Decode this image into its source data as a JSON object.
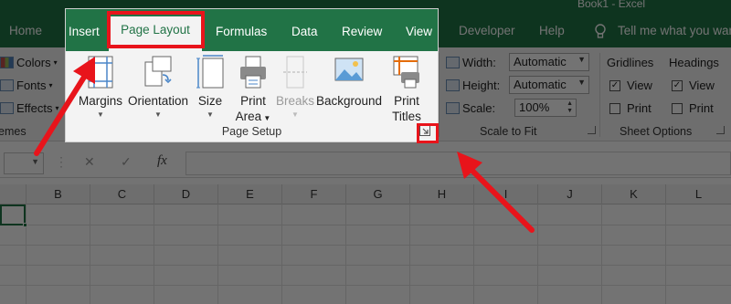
{
  "window": {
    "title": "Book1 - Excel"
  },
  "tabs": [
    "Home",
    "Insert",
    "Page Layout",
    "Formulas",
    "Data",
    "Review",
    "View",
    "Developer",
    "Help"
  ],
  "active_tab": "Page Layout",
  "tell_me": "Tell me what you want",
  "themes": {
    "colors": "Colors",
    "fonts": "Fonts",
    "effects": "Effects",
    "group": "emes"
  },
  "page_setup": {
    "commands": [
      {
        "label": "Margins",
        "sub": "",
        "caret": true,
        "icon": "margins-icon"
      },
      {
        "label": "Orientation",
        "sub": "",
        "caret": true,
        "icon": "orientation-icon"
      },
      {
        "label": "Size",
        "sub": "",
        "caret": true,
        "icon": "size-icon"
      },
      {
        "label": "Print",
        "sub": "Area",
        "caret": true,
        "icon": "print-area-icon"
      },
      {
        "label": "Breaks",
        "sub": "",
        "caret": true,
        "icon": "breaks-icon",
        "disabled": true
      },
      {
        "label": "Background",
        "sub": "",
        "caret": false,
        "icon": "background-icon"
      },
      {
        "label": "Print",
        "sub": "Titles",
        "caret": false,
        "icon": "print-titles-icon"
      }
    ],
    "group": "Page Setup"
  },
  "scale_to_fit": {
    "width_label": "Width:",
    "width_value": "Automatic",
    "height_label": "Height:",
    "height_value": "Automatic",
    "scale_label": "Scale:",
    "scale_value": "100%",
    "group": "Scale to Fit"
  },
  "sheet_options": {
    "gridlines": "Gridlines",
    "headings": "Headings",
    "view": "View",
    "print": "Print",
    "group": "Sheet Options"
  },
  "formula_bar": {
    "fx": "fx"
  },
  "columns": [
    "B",
    "C",
    "D",
    "E",
    "F",
    "G",
    "H",
    "I",
    "J",
    "K",
    "L"
  ],
  "colors": {
    "excel_green": "#217346",
    "highlight_red": "#e8141b"
  }
}
